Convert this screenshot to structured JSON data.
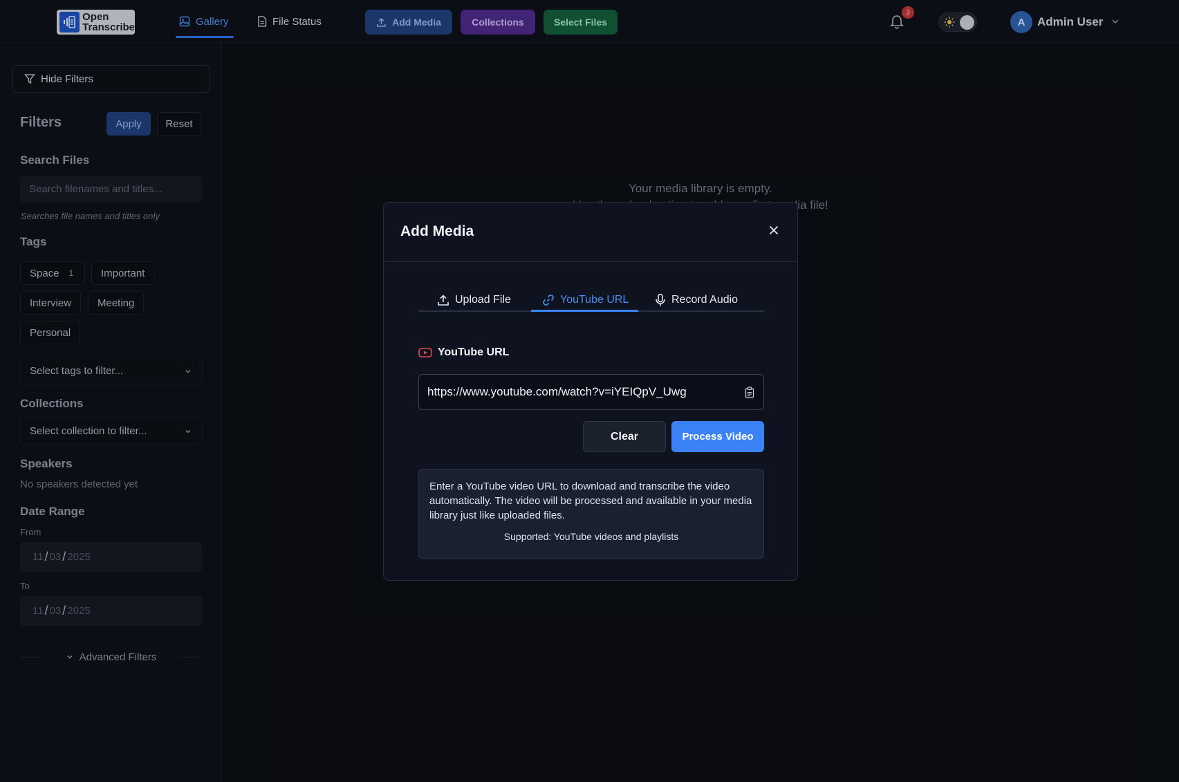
{
  "app": {
    "logo_line1": "Open",
    "logo_line2": "Transcribe"
  },
  "nav": {
    "gallery": "Gallery",
    "file_status": "File Status",
    "add_media": "Add Media",
    "collections": "Collections",
    "select_files": "Select Files"
  },
  "header": {
    "notification_count": "3",
    "user_initial": "A",
    "user_name": "Admin User"
  },
  "sidebar": {
    "hide_filters": "Hide Filters",
    "filters_title": "Filters",
    "apply": "Apply",
    "reset": "Reset",
    "search_heading": "Search Files",
    "search_placeholder": "Search filenames and titles...",
    "search_hint": "Searches file names and titles only",
    "tags_heading": "Tags",
    "tags": [
      {
        "label": "Space",
        "count": "1"
      },
      {
        "label": "Important",
        "count": ""
      },
      {
        "label": "Interview",
        "count": ""
      },
      {
        "label": "Meeting",
        "count": ""
      },
      {
        "label": "Personal",
        "count": ""
      }
    ],
    "tags_select": "Select tags to filter...",
    "collections_heading": "Collections",
    "collections_select": "Select collection to filter...",
    "speakers_heading": "Speakers",
    "speakers_empty": "No speakers detected yet",
    "date_heading": "Date Range",
    "from_label": "From",
    "from_date": {
      "day": "11",
      "month": "03",
      "year": "2025"
    },
    "to_label": "To",
    "to_date": {
      "day": "11",
      "month": "03",
      "year": "2025"
    },
    "advanced": "Advanced Filters"
  },
  "main": {
    "empty_line1": "Your media library is empty.",
    "empty_line2": "Use the upload option to add your first media file!"
  },
  "modal": {
    "title": "Add Media",
    "tabs": [
      {
        "label": "Upload File"
      },
      {
        "label": "YouTube URL"
      },
      {
        "label": "Record Audio"
      }
    ],
    "active_tab": "YouTube URL",
    "field_label": "YouTube URL",
    "url_value": "https://www.youtube.com/watch?v=iYEIQpV_Uwg",
    "clear": "Clear",
    "process": "Process Video",
    "info_text": "Enter a YouTube video URL to download and transcribe the video automatically. The video will be processed and available in your media library just like uploaded files.",
    "info_supported": "Supported: YouTube videos and playlists"
  },
  "colors": {
    "accent": "#3b82f6",
    "add_media_bg": "#1f3f78",
    "collections_bg": "#4b2a86",
    "select_files_bg": "#135a3a",
    "youtube_red": "#e5484d"
  }
}
